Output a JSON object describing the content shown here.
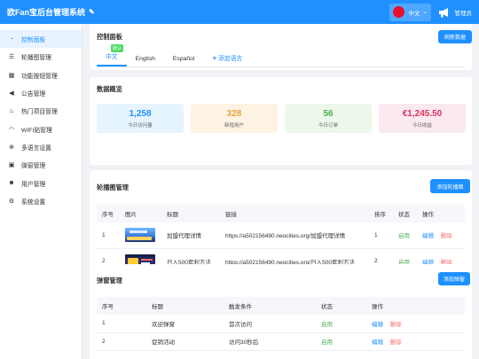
{
  "header": {
    "title": "欧Fan宝后台管理系统",
    "language": "中文",
    "admin_label": "管理员"
  },
  "sidebar": {
    "items": [
      {
        "label": "控制面板",
        "icon": "dashboard-icon",
        "active": true
      },
      {
        "label": "轮播图管理",
        "icon": "sliders-icon"
      },
      {
        "label": "功能按钮管理",
        "icon": "grid-icon"
      },
      {
        "label": "公告管理",
        "icon": "bullhorn-icon"
      },
      {
        "label": "热门项目管理",
        "icon": "fire-icon"
      },
      {
        "label": "WIFI贴管理",
        "icon": "wifi-icon"
      },
      {
        "label": "多语言设置",
        "icon": "globe-icon"
      },
      {
        "label": "弹窗管理",
        "icon": "window-icon"
      },
      {
        "label": "用户管理",
        "icon": "users-icon"
      },
      {
        "label": "系统设置",
        "icon": "gear-icon"
      }
    ]
  },
  "panel": {
    "title": "控制面板",
    "refresh_label": "刷新数据",
    "tabs": [
      {
        "label": "中文",
        "badge": "默认",
        "active": true
      },
      {
        "label": "English"
      },
      {
        "label": "Español"
      }
    ],
    "add_language_label": "添加语言"
  },
  "overview": {
    "title": "数据概览",
    "stats": [
      {
        "value": "1,258",
        "label": "今日访问量",
        "color": "#1e90ff",
        "bg": "#e6f4ff"
      },
      {
        "value": "328",
        "label": "新增用户",
        "color": "#e6a23c",
        "bg": "#fdf3e3"
      },
      {
        "value": "56",
        "label": "今日订单",
        "color": "#4cb050",
        "bg": "#edf8ea"
      },
      {
        "value": "€1,245.50",
        "label": "今日收益",
        "color": "#d9365e",
        "bg": "#fbe9f0"
      }
    ]
  },
  "carousel": {
    "title": "轮播图管理",
    "add_label": "添加轮播图",
    "columns": [
      "序号",
      "图片",
      "标题",
      "链接",
      "排序",
      "状态",
      "操作"
    ],
    "rows": [
      {
        "no": "1",
        "title": "加盟代理详情",
        "link": "https://a502156490.neocities.org/加盟代理详情",
        "order": "1",
        "status": "启用",
        "edit": "编辑",
        "delete": "删除"
      },
      {
        "no": "2",
        "title": "日入500套利方法",
        "link": "https://a502156490.neocities.org/日入500套利方法",
        "order": "2",
        "status": "启用",
        "edit": "编辑",
        "delete": "删除"
      }
    ]
  },
  "popup": {
    "title": "弹窗管理",
    "add_label": "添加弹窗",
    "columns": [
      "序号",
      "标题",
      "触发条件",
      "状态",
      "操作"
    ],
    "rows": [
      {
        "no": "1",
        "title": "欢迎弹窗",
        "trigger": "首次访问",
        "status": "启用",
        "edit": "编辑",
        "delete": "删除"
      },
      {
        "no": "2",
        "title": "促销活动",
        "trigger": "访问30秒后",
        "status": "启用",
        "edit": "编辑",
        "delete": "删除"
      }
    ]
  }
}
